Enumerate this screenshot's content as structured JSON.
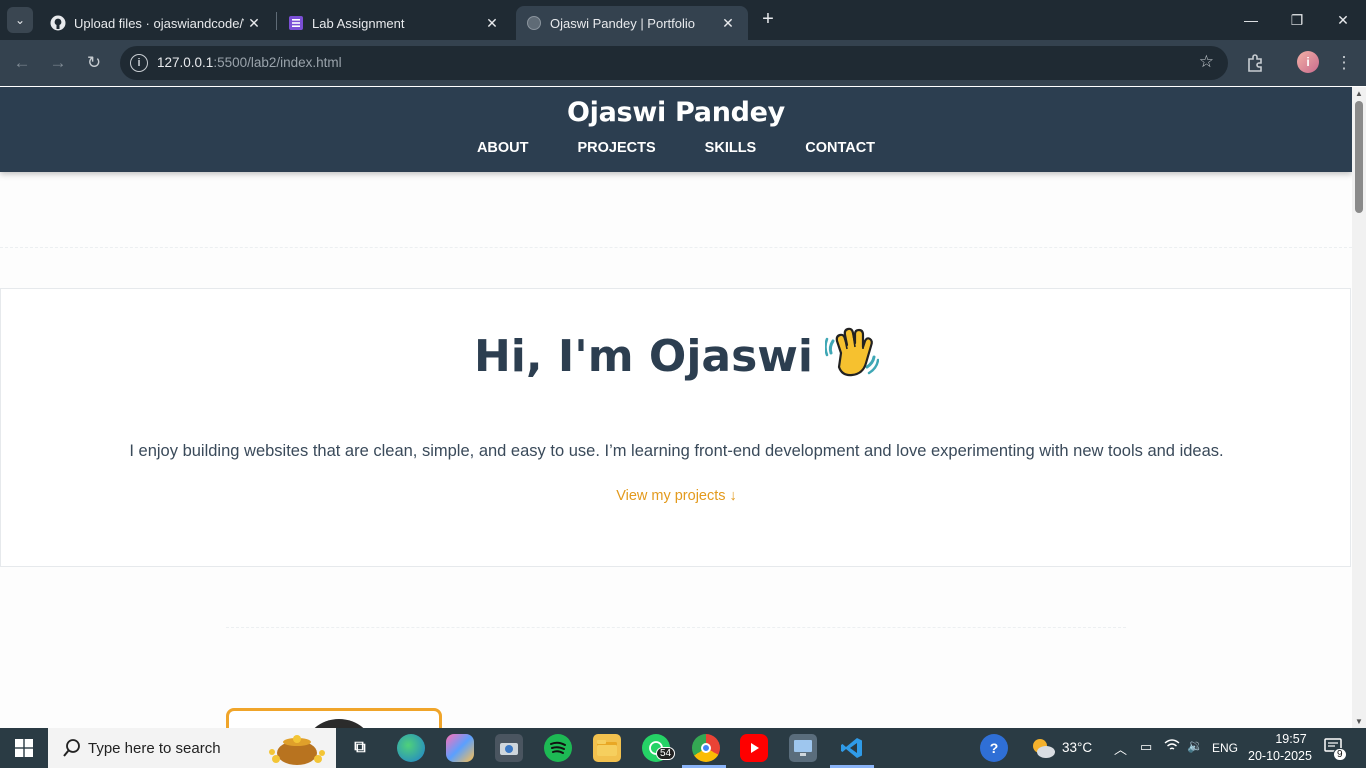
{
  "browser": {
    "tabs": [
      {
        "title": "Upload files · ojaswiandcode/W",
        "icon": "github-icon"
      },
      {
        "title": "Lab Assignment",
        "icon": "form-icon"
      },
      {
        "title": "Ojaswi Pandey | Portfolio",
        "icon": "globe-icon",
        "active": true
      }
    ],
    "url_host": "127.0.0.1",
    "url_rest": ":5500/lab2/index.html",
    "profile_initial": "i"
  },
  "site": {
    "name": "Ojaswi Pandey",
    "nav": [
      "ABOUT",
      "PROJECTS",
      "SKILLS",
      "CONTACT"
    ],
    "hero": {
      "title": "Hi, I'm Ojaswi",
      "intro": "I enjoy building websites that are clean, simple, and easy to use. I’m learning front-end development and love experimenting with new tools and ideas.",
      "cta": "View my projects ↓"
    },
    "colors": {
      "header_bg": "#2c3e50",
      "accent": "#e39a1d",
      "text": "#2c3e50"
    }
  },
  "taskbar": {
    "search_placeholder": "Type here to search",
    "whatsapp_badge": "54",
    "weather": "33°C",
    "language": "ENG",
    "time": "19:57",
    "date": "20-10-2025",
    "notifications": "9"
  }
}
